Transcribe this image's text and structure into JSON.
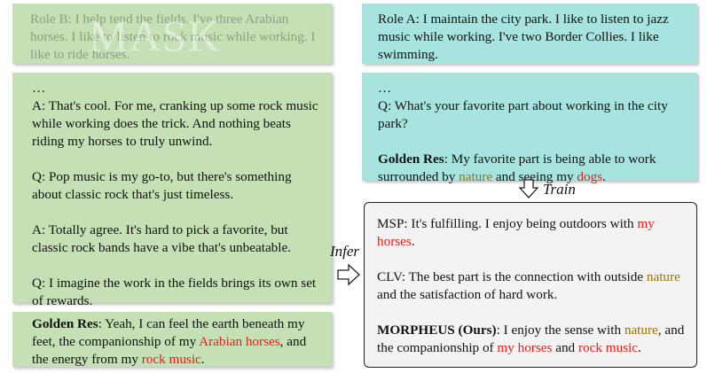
{
  "left": {
    "role_b": {
      "text": "Role B: I help tend the fields. I've three Arabian horses. I like to listen to rock music while working. I like to ride horses.",
      "watermark": "MASK"
    },
    "dialogue": {
      "ellipsis": "…",
      "turns": [
        "A: That's cool. For me, cranking up some rock music while working does the trick. And nothing beats riding my horses to truly unwind.",
        "Q: Pop music is my go-to, but there's something about classic rock that's just timeless.",
        "A: Totally agree. It's hard to pick a favorite, but classic rock bands have a vibe that's unbeatable.",
        "Q: I imagine the work in the fields brings its own set of rewards."
      ]
    },
    "golden": {
      "label": "Golden Res",
      "t1": ": Yeah, I can feel the earth beneath my feet, the companionship of my ",
      "h1": "Arabian horses",
      "t2": ", and the energy from my ",
      "h2": "rock music",
      "t3": "."
    }
  },
  "right": {
    "role_a": {
      "text": "Role A: I maintain the city park. I like to listen to jazz music while working. I've two Border Collies. I like swimming."
    },
    "dialogue": {
      "ellipsis": "…",
      "question": "Q: What's your favorite part about working in the city park?",
      "golden_label": "Golden Res",
      "g1": ": My favorite part is being able to work surrounded by ",
      "gh1": "nature",
      "g2": " and seeing my ",
      "gh2": "dogs",
      "g3": "."
    },
    "outputs": {
      "msp": {
        "t1": "MSP: It's fulfilling. I enjoy being outdoors with ",
        "h1": "my horses",
        "t2": "."
      },
      "clv": {
        "t1": "CLV: The best part is the connection with outside ",
        "h1": "nature",
        "t2": " and the satisfaction of hard work."
      },
      "morpheus": {
        "label": "MORPHEUS (Ours)",
        "t1": ": I enjoy the sense with ",
        "h1": "nature",
        "t2": ", and the companionship of ",
        "h2": "my horses",
        "t3": " and ",
        "h3": "rock music",
        "t4": "."
      }
    }
  },
  "arrows": {
    "train": "Train",
    "infer": "Infer"
  },
  "colors": {
    "green_box": "#c5e0b4",
    "teal_box": "#a8e4df",
    "output_box": "#f3f3f3",
    "highlight_red": "#e0211b",
    "highlight_gold": "#9b7209"
  }
}
